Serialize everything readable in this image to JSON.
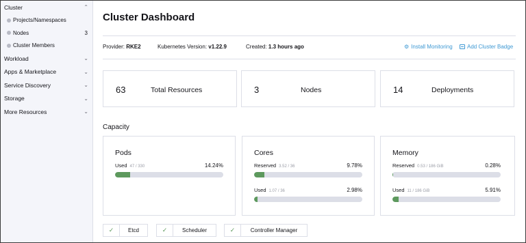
{
  "sidebar": {
    "cluster": {
      "label": "Cluster",
      "chevron": "chevron-up-icon"
    },
    "cluster_items": [
      {
        "label": "Projects/Namespaces",
        "count": ""
      },
      {
        "label": "Nodes",
        "count": "3"
      },
      {
        "label": "Cluster Members",
        "count": ""
      }
    ],
    "groups": [
      {
        "label": "Workload"
      },
      {
        "label": "Apps & Marketplace"
      },
      {
        "label": "Service Discovery"
      },
      {
        "label": "Storage"
      },
      {
        "label": "More Resources"
      }
    ]
  },
  "header": {
    "title": "Cluster Dashboard"
  },
  "meta": {
    "provider_label": "Provider:",
    "provider_value": "RKE2",
    "k8s_label": "Kubernetes Version:",
    "k8s_value": "v1.22.9",
    "created_label": "Created:",
    "created_value": "1.3 hours ago",
    "install_monitoring": "Install Monitoring",
    "add_cluster_badge": "Add Cluster Badge"
  },
  "stats": [
    {
      "number": "63",
      "label": "Total Resources"
    },
    {
      "number": "3",
      "label": "Nodes"
    },
    {
      "number": "14",
      "label": "Deployments"
    }
  ],
  "capacity": {
    "title": "Capacity",
    "cards": [
      {
        "title": "Pods",
        "metrics": [
          {
            "name": "Used",
            "value": "47 / 330",
            "pct": "14.24%",
            "fraction": 0.1424
          }
        ]
      },
      {
        "title": "Cores",
        "metrics": [
          {
            "name": "Reserved",
            "value": "3.52 / 36",
            "pct": "9.78%",
            "fraction": 0.0978
          },
          {
            "name": "Used",
            "value": "1.07 / 36",
            "pct": "2.98%",
            "fraction": 0.0298
          }
        ]
      },
      {
        "title": "Memory",
        "metrics": [
          {
            "name": "Reserved",
            "value": "0.53 / 186 GiB",
            "pct": "0.28%",
            "fraction": 0.0028
          },
          {
            "name": "Used",
            "value": "11 / 186 GiB",
            "pct": "5.91%",
            "fraction": 0.0591
          }
        ]
      }
    ]
  },
  "components": [
    {
      "label": "Etcd",
      "status": "ok"
    },
    {
      "label": "Scheduler",
      "status": "ok"
    },
    {
      "label": "Controller Manager",
      "status": "ok"
    }
  ],
  "colors": {
    "accent": "#3d98d3",
    "success": "#5d995d",
    "border": "#dcdee7",
    "sidebar_bg": "#f4f5fa"
  }
}
